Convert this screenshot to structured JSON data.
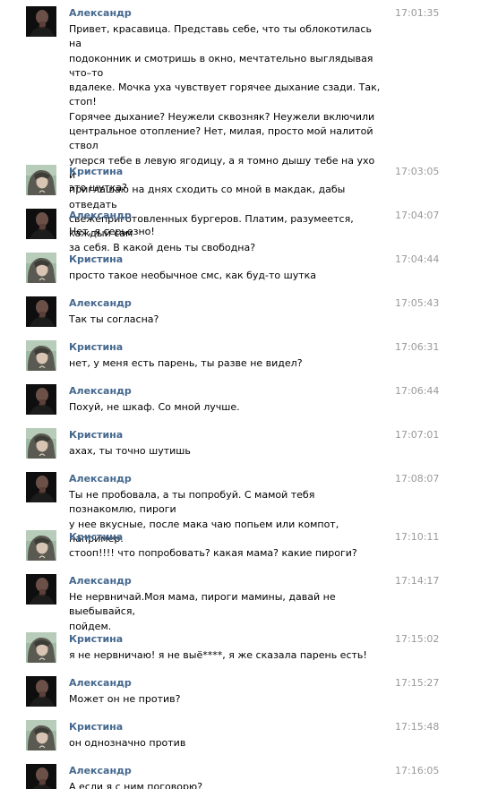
{
  "messages": [
    {
      "author": "Александр",
      "avatar": "avatar-alexander",
      "time": "17:01:35",
      "text": "Привет, красавица. Представь себе, что ты облокотилась на\nподоконник и смотришь в окно, мечтательно выглядывая что–то\nвдалеке. Мочка уха чувствует горячее дыхание сзади. Так, стоп!\nГорячее дыхание? Неужели сквозняк? Неужели включили\nцентральное отопление? Нет, милая, просто мой налитой ствол\nуперся тебе в левую ягодицу, а я томно дышу тебе на ухо и\nприглашаю на днях сходить со мной в макдак, дабы отведать\nсвежеприготовленных бургеров. Платим, разумеется, каждый сам\nза себя. В какой день ты свободна?"
    },
    {
      "author": "Кристина",
      "avatar": "avatar-kristina",
      "time": "17:03:05",
      "text": "это шутка?"
    },
    {
      "author": "Александр",
      "avatar": "avatar-alexander",
      "time": "17:04:07",
      "text": "Нет, я серьезно!"
    },
    {
      "author": "Кристина",
      "avatar": "avatar-kristina",
      "time": "17:04:44",
      "text": "просто такое необычное смс, как буд-то шутка"
    },
    {
      "author": "Александр",
      "avatar": "avatar-alexander",
      "time": "17:05:43",
      "text": "Так ты согласна?"
    },
    {
      "author": "Кристина",
      "avatar": "avatar-kristina",
      "time": "17:06:31",
      "text": "нет, у меня есть парень, ты разве не видел?"
    },
    {
      "author": "Александр",
      "avatar": "avatar-alexander",
      "time": "17:06:44",
      "text": "Похуй, не шкаф. Со мной лучше."
    },
    {
      "author": "Кристина",
      "avatar": "avatar-kristina",
      "time": "17:07:01",
      "text": "ахах, ты точно шутишь"
    },
    {
      "author": "Александр",
      "avatar": "avatar-alexander",
      "time": "17:08:07",
      "text": "Ты не пробовала, а ты попробуй. С мамой тебя познакомлю, пироги\nу нее вкусные, после мака чаю попьем или компот, например."
    },
    {
      "author": "Кристина",
      "avatar": "avatar-kristina",
      "time": "17:10:11",
      "text": "стооп!!!! что попробовать? какая мама? какие пироги?"
    },
    {
      "author": "Александр",
      "avatar": "avatar-alexander",
      "time": "17:14:17",
      "text": "Не нервничай.Моя мама, пироги мамины, давай не выебывайся,\nпойдем."
    },
    {
      "author": "Кристина",
      "avatar": "avatar-kristina",
      "time": "17:15:02",
      "text": "я не нервничаю! я не выё****, я же сказала парень есть!"
    },
    {
      "author": "Александр",
      "avatar": "avatar-alexander",
      "time": "17:15:27",
      "text": "Может он не против?"
    },
    {
      "author": "Кристина",
      "avatar": "avatar-kristina",
      "time": "17:15:48",
      "text": "он однозначно против"
    },
    {
      "author": "Александр",
      "avatar": "avatar-alexander",
      "time": "17:16:05",
      "text": "А если я с ним поговорю?"
    }
  ]
}
